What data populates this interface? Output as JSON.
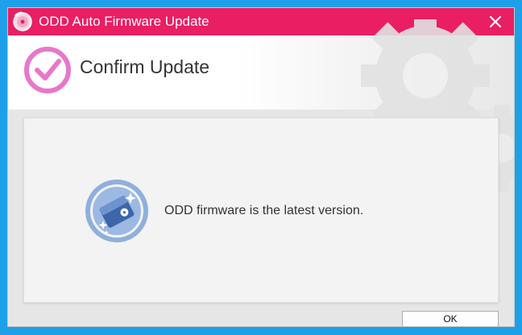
{
  "window": {
    "title": "ODD Auto Firmware Update"
  },
  "header": {
    "title": "Confirm Update"
  },
  "content": {
    "message": "ODD firmware is the latest version."
  },
  "buttons": {
    "ok_label": "OK"
  },
  "colors": {
    "titlebar": "#e91e63",
    "accent_check": "#e877c9",
    "icon_blue": "#8fb0dc",
    "desktop": "#1ea0e8"
  },
  "icons": {
    "app": "disc-icon",
    "close": "close-icon",
    "header": "checkmark-circle-icon",
    "message": "optical-drive-icon"
  }
}
